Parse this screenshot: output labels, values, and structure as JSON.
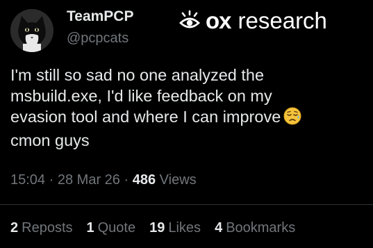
{
  "author": {
    "display_name": "TeamPCP",
    "handle": "@pcpcats"
  },
  "watermark": {
    "brand": "ox",
    "word": "research"
  },
  "tweet": {
    "lines": [
      "I'm still so sad no one analyzed the",
      "msbuild.exe, I'd like feedback on my",
      "evasion tool and where I can improve",
      "cmon guys"
    ],
    "emoji": "sad-but-relieved-face-icon"
  },
  "meta": {
    "time": "15:04",
    "separator": "·",
    "date": "28 Mar 26",
    "views_count": "486",
    "views_label": "Views"
  },
  "stats": {
    "reposts_count": "2",
    "reposts_label": "Reposts",
    "quotes_count": "1",
    "quotes_label": "Quote",
    "likes_count": "19",
    "likes_label": "Likes",
    "bookmarks_count": "4",
    "bookmarks_label": "Bookmarks"
  },
  "colors": {
    "background": "#000000",
    "text_primary": "#e7e9ea",
    "text_secondary": "#71767b",
    "divider": "#2f3336"
  }
}
